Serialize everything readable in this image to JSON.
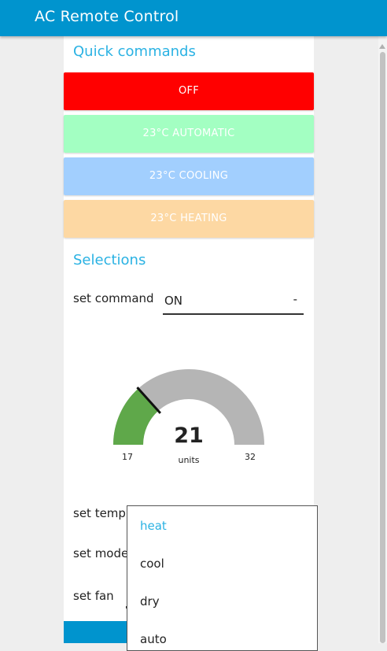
{
  "app": {
    "title": "AC Remote Control"
  },
  "quick": {
    "heading": "Quick commands",
    "buttons": [
      {
        "label": "OFF",
        "color": "#ff0000"
      },
      {
        "label": "23°C AUTOMATIC",
        "color": "#a3ffc2"
      },
      {
        "label": "23°C COOLING",
        "color": "#a2cffe"
      },
      {
        "label": "23°C HEATING",
        "color": "#fdd8a3"
      }
    ]
  },
  "selections": {
    "heading": "Selections",
    "command": {
      "label": "set command",
      "value": "ON",
      "caret": "-"
    },
    "temp_label": "set temp",
    "mode_label": "set mode",
    "fan_label": "set fan"
  },
  "gauge": {
    "value": "21",
    "units": "units",
    "min": "17",
    "max": "32",
    "fill_color": "#5fa84a",
    "track_color": "#b5b5b5"
  },
  "mode_dropdown": {
    "options": [
      "heat",
      "cool",
      "dry",
      "auto"
    ],
    "selected": "heat"
  },
  "colors": {
    "accent": "#0094ce",
    "heading": "#2ab2e3"
  }
}
